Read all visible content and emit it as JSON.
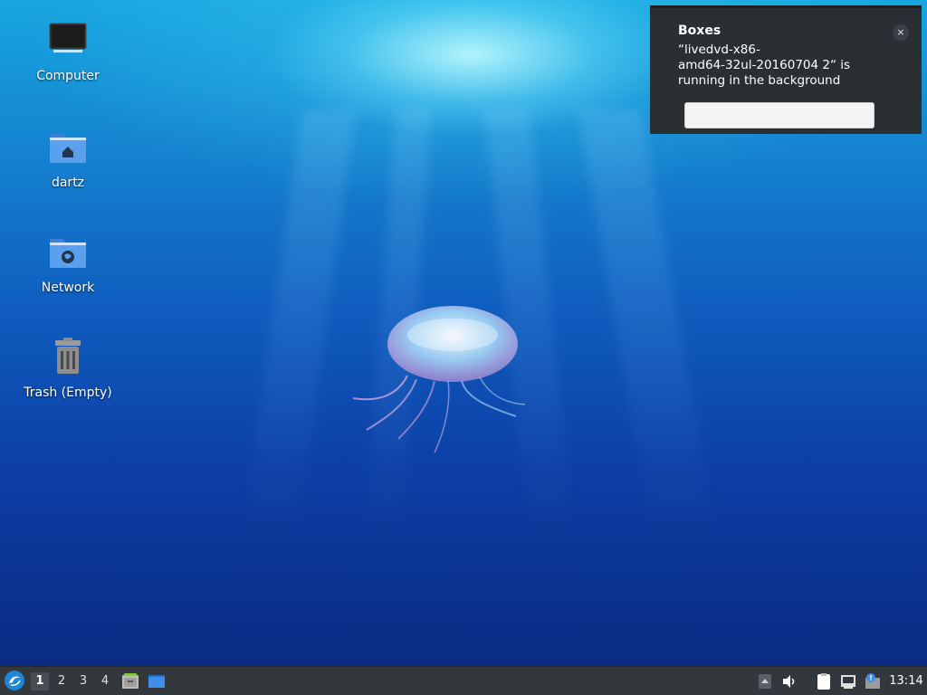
{
  "desktop": {
    "icons": [
      {
        "label": "Computer",
        "icon": "computer-icon"
      },
      {
        "label": "dartz",
        "icon": "home-folder-icon"
      },
      {
        "label": "Network",
        "icon": "network-folder-icon"
      },
      {
        "label": "Trash (Empty)",
        "icon": "trash-icon"
      }
    ]
  },
  "notification": {
    "title": "Boxes",
    "body": "“livedvd-x86-\namd64-32ul-20160704 2“ is\nrunning in the background",
    "close_label": "×",
    "action_label": ""
  },
  "taskbar": {
    "workspaces": [
      "1",
      "2",
      "3",
      "4"
    ],
    "active_workspace": "1",
    "launchers": [
      "file-manager-icon",
      "desktop-icon"
    ],
    "tray": [
      "tray-arrow-icon",
      "volume-icon",
      "clipboard-icon",
      "network-icon",
      "update-notifier-icon"
    ],
    "clock": "13:14"
  },
  "colors": {
    "panel": "#33383c",
    "notification_bg": "#2a2f33",
    "accent": "#1f87d6"
  }
}
